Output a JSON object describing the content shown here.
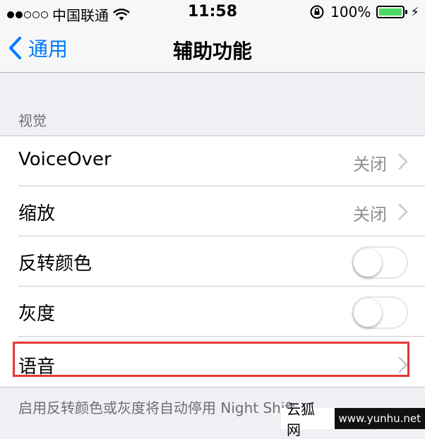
{
  "status_bar": {
    "carrier": "中国联通",
    "time": "11:58",
    "battery": "100%",
    "signal_bars_filled": 2,
    "signal_bars_total": 5
  },
  "nav": {
    "back_label": "通用",
    "title": "辅助功能"
  },
  "section": {
    "header": "视觉",
    "rows": [
      {
        "label": "VoiceOver",
        "value": "关闭"
      },
      {
        "label": "缩放",
        "value": "关闭"
      },
      {
        "label": "反转颜色",
        "toggle_on": false
      },
      {
        "label": "灰度",
        "toggle_on": false
      },
      {
        "label": "语音"
      }
    ],
    "footer": "启用反转颜色或灰度将自动停用 Night Shift"
  },
  "watermark": {
    "text": "云狐网",
    "url": "www.yunhu.net"
  },
  "colors": {
    "accent": "#007aff",
    "highlight": "#e53935",
    "battery": "#4cd964"
  }
}
